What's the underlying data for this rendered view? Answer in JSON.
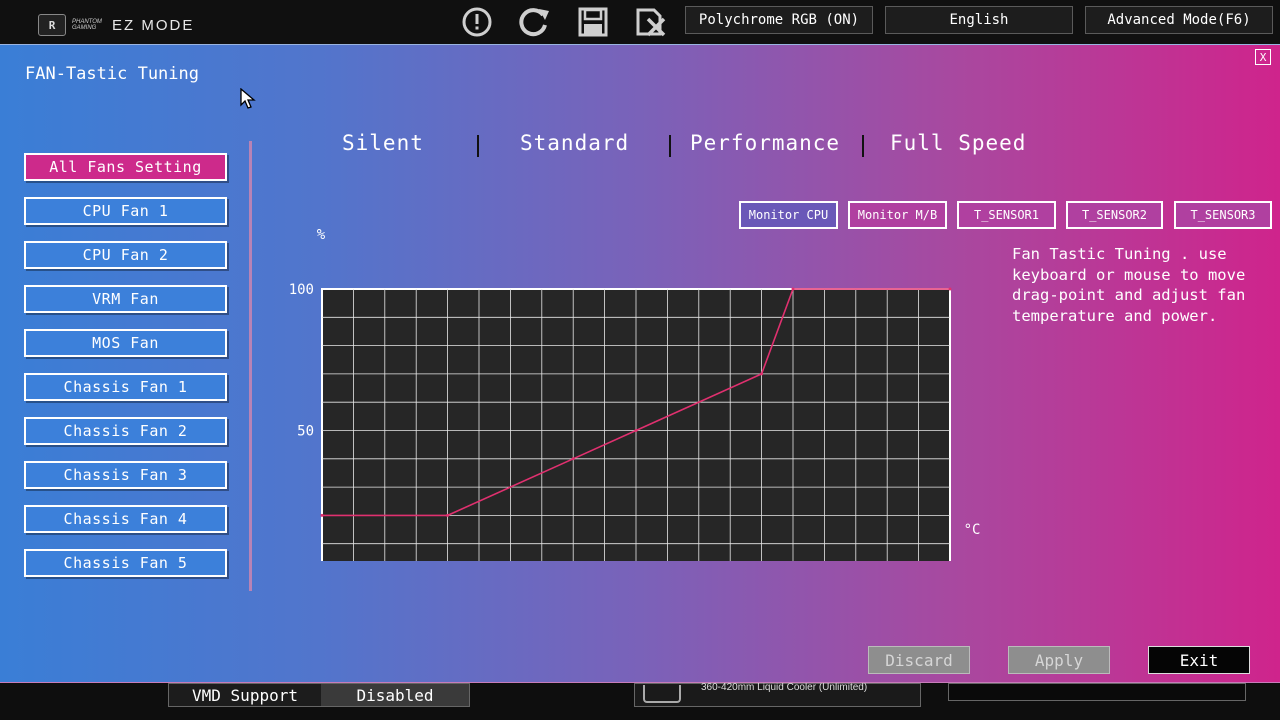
{
  "header": {
    "brand_small": "PHANTOM GAMING",
    "mode": "EZ MODE",
    "icons": [
      "alert-icon",
      "refresh-icon",
      "save-icon",
      "discard-exit-icon"
    ],
    "polychrome_label": "Polychrome RGB (ON)",
    "language_label": "English",
    "advanced_label": "Advanced Mode(F6)"
  },
  "background": {
    "vmd_label": "VMD Support",
    "vmd_value": "Disabled",
    "cooler_text": "360-420mm Liquid Cooler (Unlimited)"
  },
  "dialog": {
    "title": "FAN-Tastic Tuning",
    "close_label": "X",
    "fans": [
      {
        "label": "All Fans Setting",
        "active": true
      },
      {
        "label": "CPU Fan 1"
      },
      {
        "label": "CPU Fan 2"
      },
      {
        "label": "VRM Fan"
      },
      {
        "label": "MOS Fan"
      },
      {
        "label": "Chassis Fan 1"
      },
      {
        "label": "Chassis Fan 2"
      },
      {
        "label": "Chassis Fan 3"
      },
      {
        "label": "Chassis Fan 4"
      },
      {
        "label": "Chassis Fan 5"
      }
    ],
    "modes": [
      "Silent",
      "Standard",
      "Performance",
      "Full Speed"
    ],
    "monitors": [
      {
        "label": "Monitor CPU",
        "selected": true
      },
      {
        "label": "Monitor M/B"
      },
      {
        "label": "T_SENSOR1"
      },
      {
        "label": "T_SENSOR2"
      },
      {
        "label": "T_SENSOR3"
      }
    ],
    "help_text": "Fan Tastic Tuning . use keyboard or mouse to move drag-point and adjust fan temperature and power.",
    "actions": {
      "discard": "Discard",
      "apply": "Apply",
      "exit": "Exit"
    }
  },
  "chart_data": {
    "type": "line",
    "x_unit": "°C",
    "y_unit": "%",
    "xlim": [
      0,
      100
    ],
    "ylim": [
      0,
      100
    ],
    "x_ticks": [
      0,
      25,
      50,
      75,
      100
    ],
    "y_ticks": [
      50,
      100
    ],
    "grid": true,
    "series": [
      {
        "points": [
          [
            0,
            20
          ],
          [
            20,
            20
          ],
          [
            40,
            40
          ],
          [
            50,
            50
          ],
          [
            70,
            70
          ],
          [
            75,
            100
          ],
          [
            100,
            100
          ]
        ],
        "color": "#e0306f"
      }
    ]
  }
}
